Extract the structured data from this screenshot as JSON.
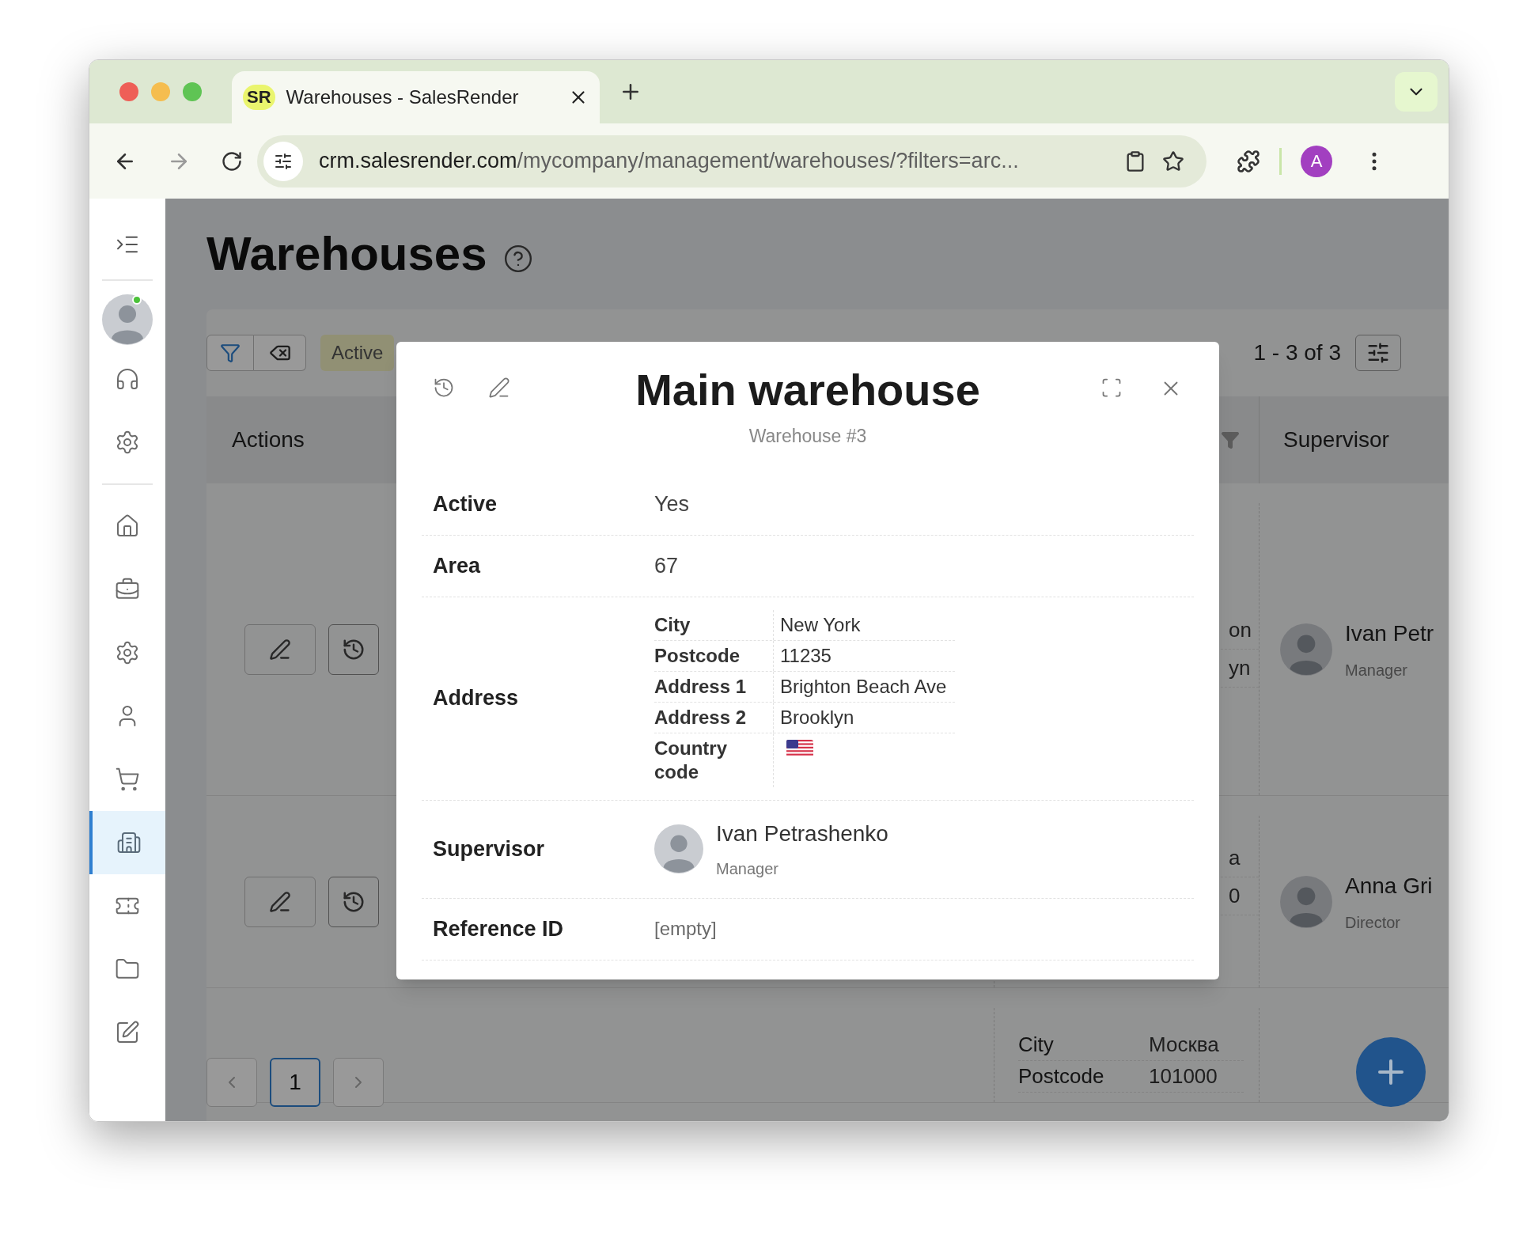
{
  "browser": {
    "tab": {
      "logo": "SR",
      "title": "Warehouses - SalesRender"
    },
    "url": {
      "host": "crm.salesrender.com",
      "path": "/mycompany/management/warehouses/?filters=arc..."
    },
    "forward_disabled": true,
    "profile_initial": "A"
  },
  "sidebar": {
    "top": [
      {
        "kind": "avatar",
        "online": true
      },
      {
        "kind": "support"
      },
      {
        "kind": "settings"
      }
    ],
    "nav": [
      {
        "kind": "home",
        "selected": false
      },
      {
        "kind": "briefcase",
        "selected": false
      },
      {
        "kind": "settings",
        "selected": false
      },
      {
        "kind": "user",
        "selected": false
      },
      {
        "kind": "cart",
        "selected": false
      },
      {
        "kind": "warehouse",
        "selected": true
      },
      {
        "kind": "ticket",
        "selected": false
      },
      {
        "kind": "folder",
        "selected": false
      },
      {
        "kind": "edit",
        "selected": false
      }
    ]
  },
  "page": {
    "title": "Warehouses"
  },
  "toolbar": {
    "filter_chip": "Active",
    "range": "1 - 3 of 3"
  },
  "table": {
    "header": {
      "actions": "Actions",
      "supervisor": "Supervisor"
    },
    "rows": [
      {
        "kind": "partial",
        "address_fragments": [
          "on",
          "yn"
        ],
        "supervisor": {
          "name": "Ivan Petr",
          "role": "Manager"
        }
      },
      {
        "kind": "partial",
        "address_fragments": [
          "a",
          "0"
        ],
        "supervisor": {
          "name": "Anna Gri",
          "role": "Director"
        }
      },
      {
        "kind": "address",
        "address": [
          {
            "label": "City",
            "value": "Москва"
          },
          {
            "label": "Postcode",
            "value": "101000"
          }
        ]
      }
    ]
  },
  "pagination": {
    "pages": [
      {
        "label": "1",
        "selected": true
      }
    ]
  },
  "modal": {
    "title": "Main warehouse",
    "subtitle": "Warehouse #3",
    "fields": [
      {
        "kind": "text",
        "label": "Active",
        "value": "Yes"
      },
      {
        "kind": "text",
        "label": "Area",
        "value": "67"
      },
      {
        "kind": "address",
        "label": "Address",
        "rows": [
          {
            "kind": "text",
            "label": "City",
            "value": "New York"
          },
          {
            "kind": "text",
            "label": "Postcode",
            "value": "11235"
          },
          {
            "kind": "text",
            "label": "Address 1",
            "value": "Brighton Beach Ave"
          },
          {
            "kind": "text",
            "label": "Address 2",
            "value": "Brooklyn"
          },
          {
            "kind": "flag",
            "label": "Country code"
          }
        ]
      },
      {
        "kind": "person",
        "label": "Supervisor",
        "name": "Ivan Petrashenko",
        "role": "Manager"
      },
      {
        "kind": "empty",
        "label": "Reference ID",
        "value": "[empty]"
      }
    ]
  }
}
